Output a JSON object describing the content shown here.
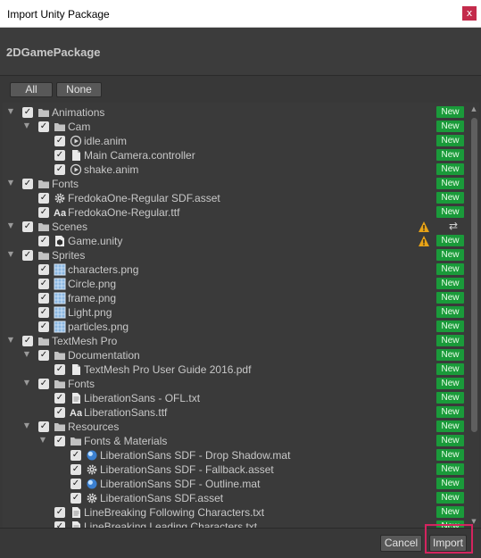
{
  "window": {
    "title": "Import Unity Package",
    "close_glyph": "x"
  },
  "package_name": "2DGamePackage",
  "select_buttons": {
    "all": "All",
    "none": "None"
  },
  "tree": [
    {
      "label": "Animations",
      "icon": "folder-icon",
      "badge": "New",
      "depth": 0,
      "expanded": true
    },
    {
      "label": "Cam",
      "icon": "folder-icon",
      "badge": "New",
      "depth": 1,
      "expanded": true
    },
    {
      "label": "idle.anim",
      "icon": "animation-clip-icon",
      "badge": "New",
      "depth": 2
    },
    {
      "label": "Main Camera.controller",
      "icon": "document-icon",
      "badge": "New",
      "depth": 2
    },
    {
      "label": "shake.anim",
      "icon": "animation-clip-icon",
      "badge": "New",
      "depth": 2
    },
    {
      "label": "Fonts",
      "icon": "folder-icon",
      "badge": "New",
      "depth": 0,
      "expanded": true
    },
    {
      "label": "FredokaOne-Regular SDF.asset",
      "icon": "gear-icon",
      "badge": "New",
      "depth": 1
    },
    {
      "label": "FredokaOne-Regular.ttf",
      "icon": "font-icon",
      "icon_text": "Aa",
      "badge": "New",
      "depth": 1
    },
    {
      "label": "Scenes",
      "icon": "folder-icon",
      "badge": "",
      "depth": 0,
      "expanded": true,
      "warning": true,
      "sync": true
    },
    {
      "label": "Game.unity",
      "icon": "unity-scene-icon",
      "badge": "New",
      "depth": 1,
      "warning": true
    },
    {
      "label": "Sprites",
      "icon": "folder-icon",
      "badge": "New",
      "depth": 0,
      "expanded": true
    },
    {
      "label": "characters.png",
      "icon": "sprite-icon",
      "badge": "New",
      "depth": 1
    },
    {
      "label": "Circle.png",
      "icon": "sprite-icon",
      "badge": "New",
      "depth": 1
    },
    {
      "label": "frame.png",
      "icon": "sprite-icon",
      "badge": "New",
      "depth": 1
    },
    {
      "label": "Light.png",
      "icon": "sprite-icon",
      "badge": "New",
      "depth": 1
    },
    {
      "label": "particles.png",
      "icon": "sprite-icon",
      "badge": "New",
      "depth": 1
    },
    {
      "label": "TextMesh Pro",
      "icon": "folder-icon",
      "badge": "New",
      "depth": 0,
      "expanded": true
    },
    {
      "label": "Documentation",
      "icon": "folder-icon",
      "badge": "New",
      "depth": 1,
      "expanded": true
    },
    {
      "label": "TextMesh Pro User Guide 2016.pdf",
      "icon": "document-icon",
      "badge": "New",
      "depth": 2
    },
    {
      "label": "Fonts",
      "icon": "folder-icon",
      "badge": "New",
      "depth": 1,
      "expanded": true
    },
    {
      "label": "LiberationSans - OFL.txt",
      "icon": "text-file-icon",
      "badge": "New",
      "depth": 2
    },
    {
      "label": "LiberationSans.ttf",
      "icon": "font-icon",
      "icon_text": "Aa",
      "badge": "New",
      "depth": 2
    },
    {
      "label": "Resources",
      "icon": "folder-icon",
      "badge": "New",
      "depth": 1,
      "expanded": true
    },
    {
      "label": "Fonts & Materials",
      "icon": "folder-icon",
      "badge": "New",
      "depth": 2,
      "expanded": true
    },
    {
      "label": "LiberationSans SDF - Drop Shadow.mat",
      "icon": "material-icon",
      "badge": "New",
      "depth": 3
    },
    {
      "label": "LiberationSans SDF - Fallback.asset",
      "icon": "gear-icon",
      "badge": "New",
      "depth": 3
    },
    {
      "label": "LiberationSans SDF - Outline.mat",
      "icon": "material-icon",
      "badge": "New",
      "depth": 3
    },
    {
      "label": "LiberationSans SDF.asset",
      "icon": "gear-icon",
      "badge": "New",
      "depth": 3
    },
    {
      "label": "LineBreaking Following Characters.txt",
      "icon": "text-file-icon",
      "badge": "New",
      "depth": 2
    },
    {
      "label": "LineBreaking Leading Characters.txt",
      "icon": "text-file-icon",
      "badge": "New",
      "depth": 2
    }
  ],
  "footer": {
    "cancel": "Cancel",
    "import": "Import"
  },
  "colors": {
    "badge_new": "#1a9a3a",
    "highlight": "#d4245f",
    "warning": "#e8a317"
  }
}
